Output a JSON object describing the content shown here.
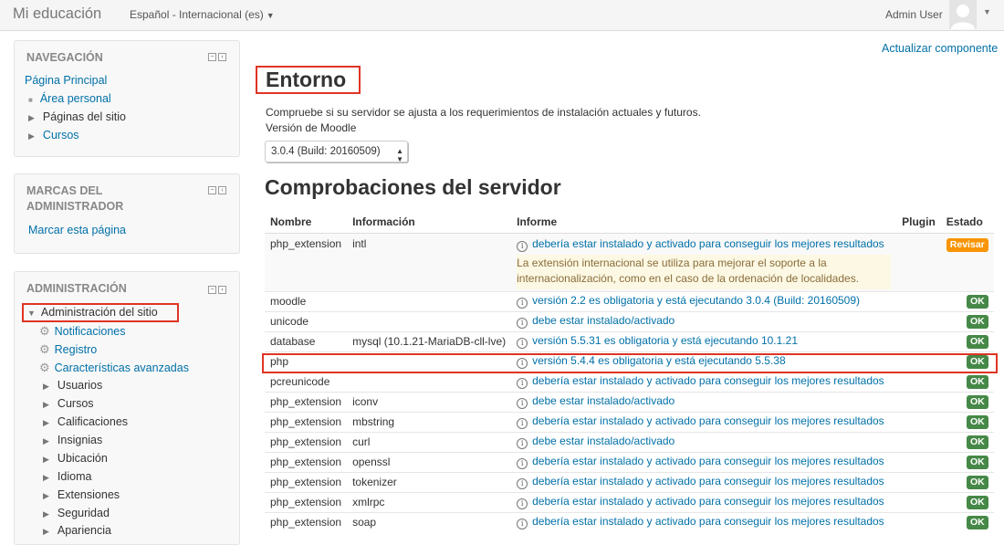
{
  "navbar": {
    "brand": "Mi educación",
    "language": "Español - Internacional (es)",
    "user_name": "Admin User"
  },
  "blocks": {
    "navegacion": {
      "title": "NAVEGACIÓN",
      "items": [
        "Página Principal",
        "Área personal",
        "Páginas del sitio",
        "Cursos"
      ]
    },
    "marcas": {
      "title_line1": "MARCAS DEL",
      "title_line2": "ADMINISTRADOR",
      "link": "Marcar esta página"
    },
    "administracion": {
      "title": "ADMINISTRACIÓN",
      "root": "Administración del sitio",
      "items": [
        "Notificaciones",
        "Registro",
        "Características avanzadas",
        "Usuarios",
        "Cursos",
        "Calificaciones",
        "Insignias",
        "Ubicación",
        "Idioma",
        "Extensiones",
        "Seguridad",
        "Apariencia"
      ]
    }
  },
  "main": {
    "update_link": "Actualizar componente",
    "heading": "Entorno",
    "intro": "Compruebe si su servidor se ajusta a los requerimientos de instalación actuales y futuros.",
    "version_label": "Versión de Moodle",
    "version_selected": "3.0.4 (Build: 20160509)",
    "section_title": "Comprobaciones del servidor",
    "columns": [
      "Nombre",
      "Información",
      "Informe",
      "Plugin",
      "Estado"
    ],
    "rows": [
      {
        "name": "php_extension",
        "info": "intl",
        "report": "debería estar instalado y activado para conseguir los mejores resultados",
        "note": "La extensión internacional se utiliza para mejorar el soporte a la internacionalización, como en el caso de la ordenación de localidades.",
        "plugin": "",
        "status": "Revisar",
        "status_color": "#f89406"
      },
      {
        "name": "moodle",
        "info": "",
        "report": "versión 2.2 es obligatoria y está ejecutando 3.0.4 (Build: 20160509)",
        "plugin": "",
        "status": "OK",
        "status_color": "#468847"
      },
      {
        "name": "unicode",
        "info": "",
        "report": "debe estar instalado/activado",
        "plugin": "",
        "status": "OK",
        "status_color": "#468847"
      },
      {
        "name": "database",
        "info": "mysql (10.1.21-MariaDB-cll-lve)",
        "report": "versión 5.5.31 es obligatoria y está ejecutando 10.1.21",
        "plugin": "",
        "status": "OK",
        "status_color": "#468847"
      },
      {
        "name": "php",
        "info": "",
        "report": "versión 5.4.4 es obligatoria y está ejecutando 5.5.38",
        "plugin": "",
        "status": "OK",
        "status_color": "#468847"
      },
      {
        "name": "pcreunicode",
        "info": "",
        "report": "debería estar instalado y activado para conseguir los mejores resultados",
        "plugin": "",
        "status": "OK",
        "status_color": "#468847"
      },
      {
        "name": "php_extension",
        "info": "iconv",
        "report": "debe estar instalado/activado",
        "plugin": "",
        "status": "OK",
        "status_color": "#468847"
      },
      {
        "name": "php_extension",
        "info": "mbstring",
        "report": "debería estar instalado y activado para conseguir los mejores resultados",
        "plugin": "",
        "status": "OK",
        "status_color": "#468847"
      },
      {
        "name": "php_extension",
        "info": "curl",
        "report": "debe estar instalado/activado",
        "plugin": "",
        "status": "OK",
        "status_color": "#468847"
      },
      {
        "name": "php_extension",
        "info": "openssl",
        "report": "debería estar instalado y activado para conseguir los mejores resultados",
        "plugin": "",
        "status": "OK",
        "status_color": "#468847"
      },
      {
        "name": "php_extension",
        "info": "tokenizer",
        "report": "debería estar instalado y activado para conseguir los mejores resultados",
        "plugin": "",
        "status": "OK",
        "status_color": "#468847"
      },
      {
        "name": "php_extension",
        "info": "xmlrpc",
        "report": "debería estar instalado y activado para conseguir los mejores resultados",
        "plugin": "",
        "status": "OK",
        "status_color": "#468847"
      },
      {
        "name": "php_extension",
        "info": "soap",
        "report": "debería estar instalado y activado para conseguir los mejores resultados",
        "plugin": "",
        "status": "OK",
        "status_color": "#468847"
      }
    ]
  },
  "colors": {
    "link": "#0070a8",
    "highlight": "#e03424",
    "ok": "#468847",
    "warning": "#f89406"
  }
}
